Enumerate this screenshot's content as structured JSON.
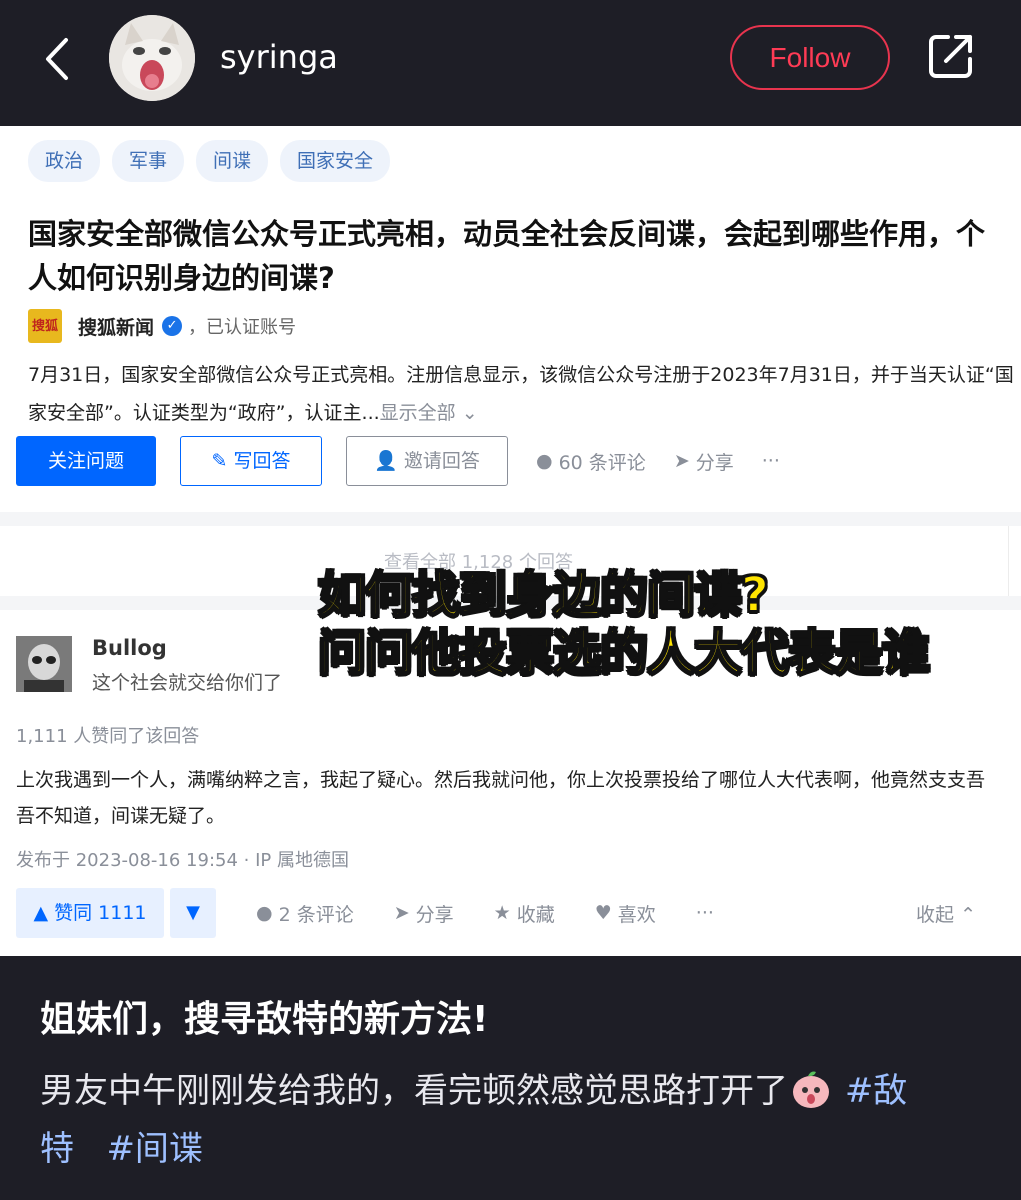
{
  "header": {
    "username": "syringa",
    "follow_label": "Follow"
  },
  "screenshot": {
    "tags": [
      "政治",
      "军事",
      "间谍",
      "国家安全"
    ],
    "question_title": "国家安全部微信公众号正式亮相，动员全社会反间谍，会起到哪些作用，个人如何识别身边的间谍?",
    "source": {
      "logo_text": "搜狐",
      "name": "搜狐新闻",
      "verified_text": "，已认证账号"
    },
    "excerpt": "7月31日，国家安全部微信公众号正式亮相。注册信息显示，该微信公众号注册于2023年7月31日，并于当天认证“国家安全部”。认证类型为“政府”，认证主...",
    "excerpt_more": "显示全部 ⌄",
    "buttons": {
      "follow_question": "关注问题",
      "write_answer": "写回答",
      "invite_answer": "邀请回答",
      "comments": "60 条评论",
      "share": "分享",
      "more": "···"
    },
    "view_all": "查看全部 1,128 个回答",
    "overlay_line1": "如何找到身边的间谍?",
    "overlay_line2": "问问他投票选的人大代表是谁",
    "answer": {
      "author": "Bullog",
      "bio": "这个社会就交给你们了",
      "likes": "1,111 人赞同了该回答",
      "body": "上次我遇到一个人，满嘴纳粹之言，我起了疑心。然后我就问他，你上次投票投给了哪位人大代表啊，他竟然支支吾吾不知道，间谍无疑了。",
      "time": "发布于 2023-08-16 19:54 · IP 属地德国",
      "vote_label": "▲ 赞同 1111",
      "vote_down": "▼",
      "comments": "2 条评论",
      "share": "分享",
      "collect": "收藏",
      "like": "喜欢",
      "more": "···",
      "collapse": "收起 ⌃"
    }
  },
  "caption": {
    "title": "姐妹们，搜寻敌特的新方法!",
    "body": "男友中午刚刚发给我的，看完顿然感觉思路打开了",
    "hashtag1": "#敌特",
    "hashtag2": "#间谍"
  },
  "colors": {
    "accent_blue": "#0066ff",
    "follow_red": "#ff3b55",
    "overlay_yellow": "#ffe400"
  }
}
